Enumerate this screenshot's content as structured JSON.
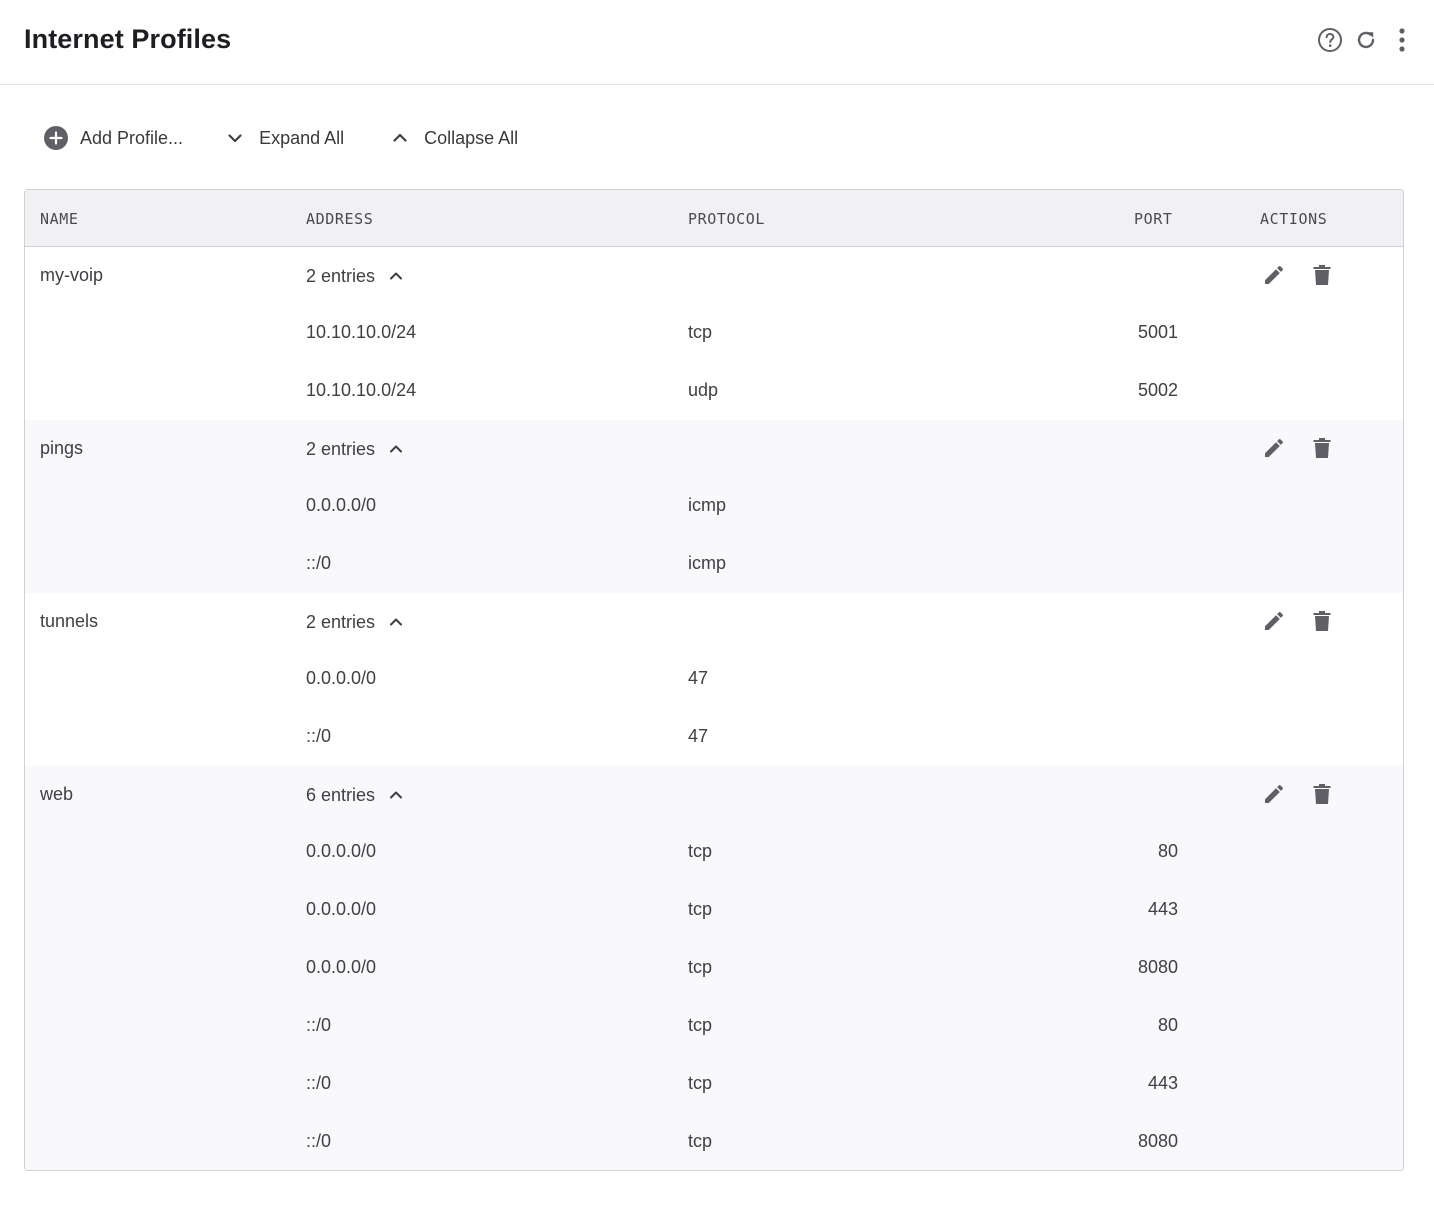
{
  "header": {
    "title": "Internet Profiles",
    "icons": [
      "help-circle-icon",
      "refresh-icon",
      "more-vertical-icon"
    ]
  },
  "toolbar": {
    "add_label": "Add Profile...",
    "expand_label": "Expand All",
    "collapse_label": "Collapse All"
  },
  "table": {
    "columns": {
      "name": "NAME",
      "address": "ADDRESS",
      "protocol": "PROTOCOL",
      "port": "PORT",
      "actions": "ACTIONS"
    },
    "profiles": [
      {
        "name": "my-voip",
        "entries_label": "2 entries",
        "entries": [
          {
            "address": "10.10.10.0/24",
            "protocol": "tcp",
            "port": "5001"
          },
          {
            "address": "10.10.10.0/24",
            "protocol": "udp",
            "port": "5002"
          }
        ]
      },
      {
        "name": "pings",
        "entries_label": "2 entries",
        "entries": [
          {
            "address": "0.0.0.0/0",
            "protocol": "icmp",
            "port": ""
          },
          {
            "address": "::/0",
            "protocol": "icmp",
            "port": ""
          }
        ]
      },
      {
        "name": "tunnels",
        "entries_label": "2 entries",
        "entries": [
          {
            "address": "0.0.0.0/0",
            "protocol": "47",
            "port": ""
          },
          {
            "address": "::/0",
            "protocol": "47",
            "port": ""
          }
        ]
      },
      {
        "name": "web",
        "entries_label": "6 entries",
        "entries": [
          {
            "address": "0.0.0.0/0",
            "protocol": "tcp",
            "port": "80"
          },
          {
            "address": "0.0.0.0/0",
            "protocol": "tcp",
            "port": "443"
          },
          {
            "address": "0.0.0.0/0",
            "protocol": "tcp",
            "port": "8080"
          },
          {
            "address": "::/0",
            "protocol": "tcp",
            "port": "80"
          },
          {
            "address": "::/0",
            "protocol": "tcp",
            "port": "443"
          },
          {
            "address": "::/0",
            "protocol": "tcp",
            "port": "8080"
          }
        ]
      }
    ]
  },
  "colors": {
    "icon": "#5f5f66",
    "header_bg": "#f1f0f3",
    "alt_row_bg": "#f9f8fb",
    "border": "#cfcfd5"
  }
}
